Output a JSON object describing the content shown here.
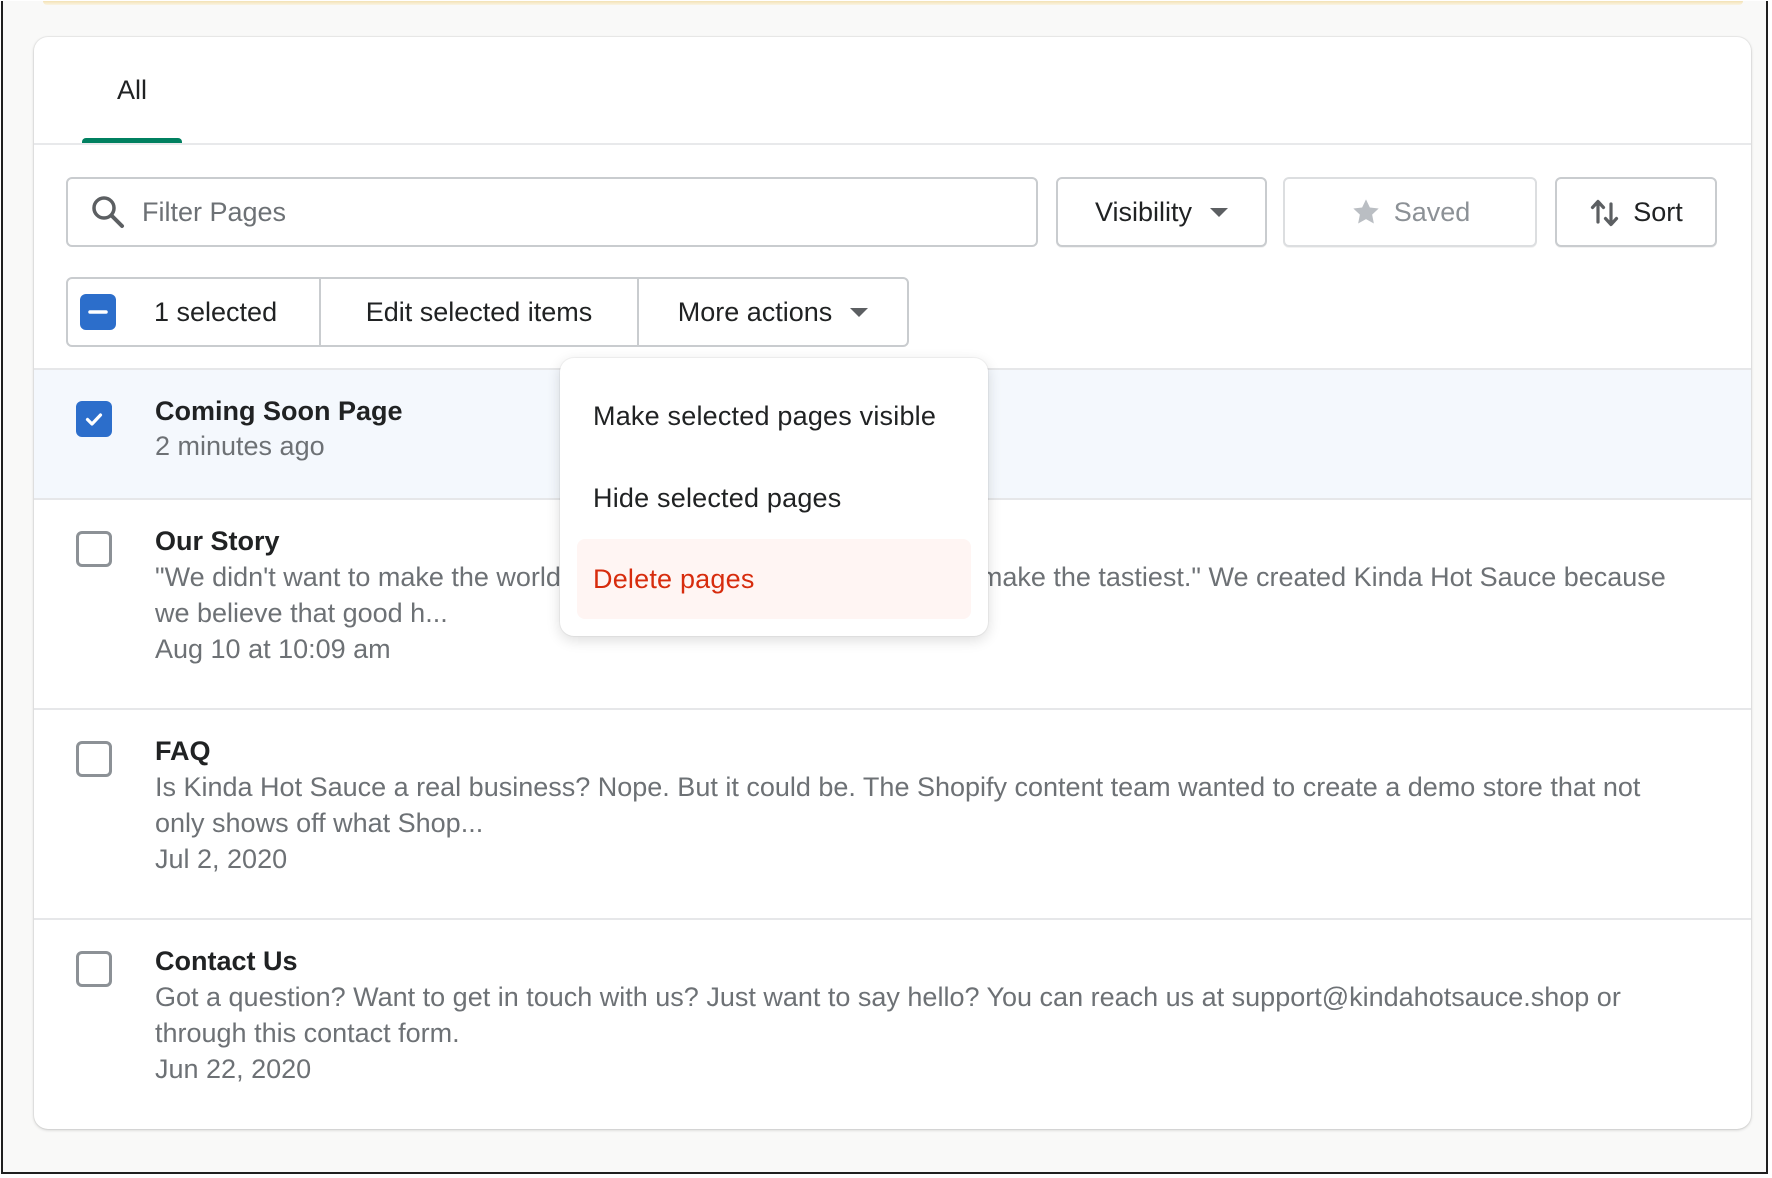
{
  "tabs": [
    {
      "label": "All",
      "active": true
    }
  ],
  "toolbar": {
    "search_placeholder": "Filter Pages",
    "search_value": "",
    "visibility_label": "Visibility",
    "saved_label": "Saved",
    "sort_label": "Sort"
  },
  "bulk_actions": {
    "selected_count_label": "1 selected",
    "edit_label": "Edit selected items",
    "more_actions_label": "More actions"
  },
  "more_actions_menu": {
    "items": [
      {
        "label": "Make selected pages visible",
        "destructive": false
      },
      {
        "label": "Hide selected pages",
        "destructive": false
      },
      {
        "label": "Delete pages",
        "destructive": true
      }
    ]
  },
  "pages": [
    {
      "title": "Coming Soon Page",
      "description": "",
      "date": "2 minutes ago",
      "selected": true
    },
    {
      "title": "Our Story",
      "description": "\"We didn't want to make the world's hottest hot sauce. We wanted to make the tastiest.\" We created Kinda Hot Sauce because we believe that good h...",
      "description_visible_line1": "\"We didn't want to make the wo",
      "description_visible_line1_right": "ed to make the tastiest.\" We created Kinda Hot Sauce",
      "description_visible_line2": "because we believe that good h",
      "date": "Aug 10 at 10:09 am",
      "selected": false
    },
    {
      "title": "FAQ",
      "description": "Is Kinda Hot Sauce a real business? Nope. But it could be. The Shopify content team wanted to create a demo store that not only shows off what Shop...",
      "date": "Jul 2, 2020",
      "selected": false
    },
    {
      "title": "Contact Us",
      "description": "Got a question? Want to get in touch with us? Just want to say hello? You can reach us at support@kindahotsauce.shop or through this contact form.",
      "date": "Jun 22, 2020",
      "selected": false
    }
  ],
  "colors": {
    "accent": "#008060",
    "checkbox_selected": "#2c6ecb",
    "selected_row_bg": "#f4f8fd",
    "destructive": "#d72c0d",
    "destructive_bg": "#fff5f3"
  },
  "icons": {
    "search": "search-icon",
    "caret": "caret-down-icon",
    "star": "star-icon",
    "sort": "sort-arrows-icon",
    "checkbox_indeterminate": "minus-icon",
    "checkbox_checked": "checkmark-icon"
  }
}
